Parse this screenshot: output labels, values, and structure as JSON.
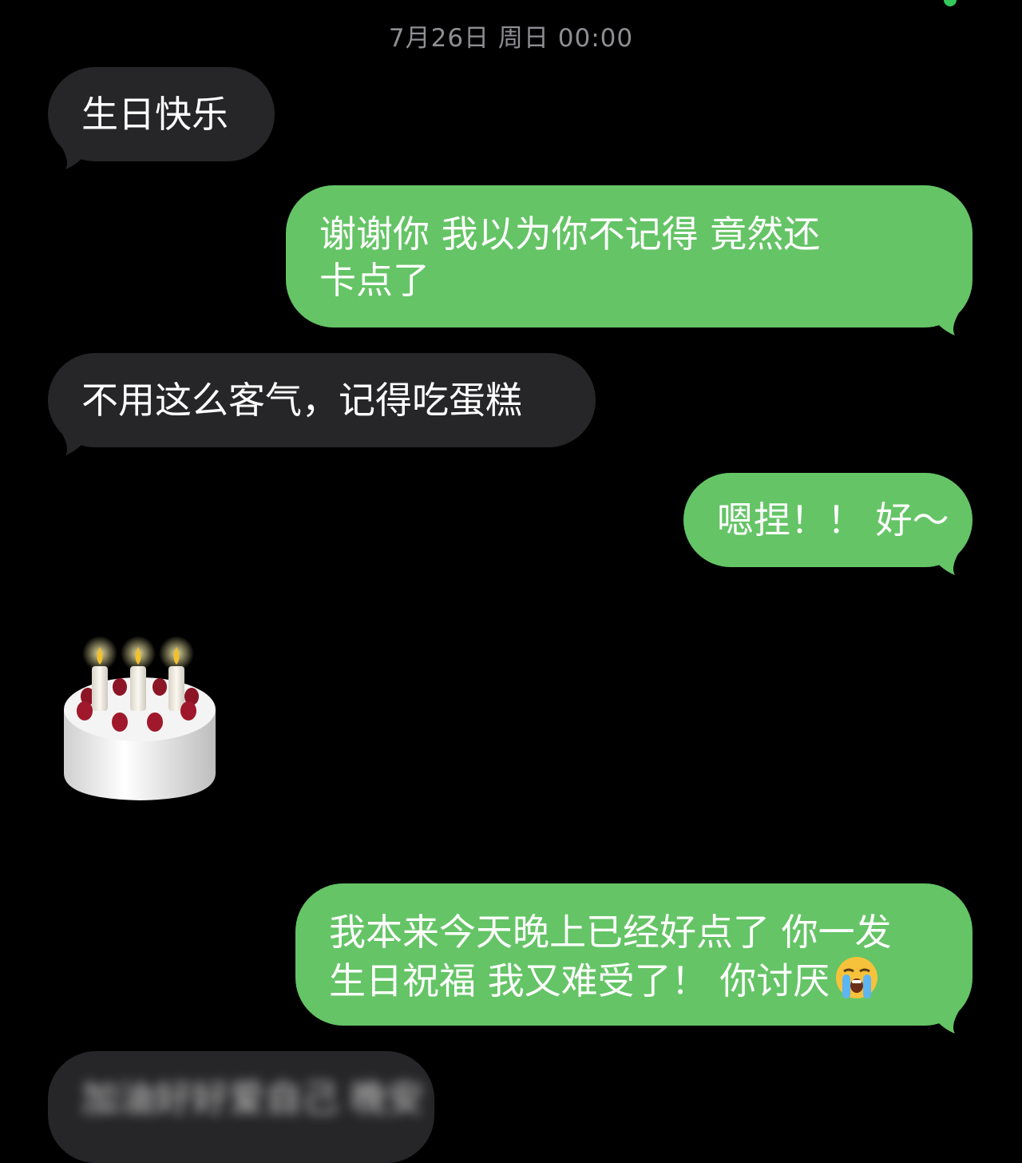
{
  "header": {
    "timestamp": "7月26日 周日 00:00"
  },
  "messages": [
    {
      "sender": "them",
      "text": "生日快乐"
    },
    {
      "sender": "me",
      "text": "谢谢你 我以为你不记得 竟然还\n卡点了"
    },
    {
      "sender": "them",
      "text": "不用这么客气，记得吃蛋糕"
    },
    {
      "sender": "me",
      "text": "嗯捏！！ 好～"
    },
    {
      "sender": "them",
      "emoji": "birthday-cake"
    },
    {
      "sender": "me",
      "text": "我本来今天晚上已经好点了 你一发\n生日祝福 我又难受了！ 你讨厌",
      "trailing_emoji": "loudly-crying-face"
    },
    {
      "sender": "them",
      "text": "加油好好爱自己 晚安"
    }
  ],
  "colors": {
    "background": "#000000",
    "incoming_bubble": "#262628",
    "outgoing_bubble": "#65c466",
    "timestamp_text": "#8e8e93"
  }
}
